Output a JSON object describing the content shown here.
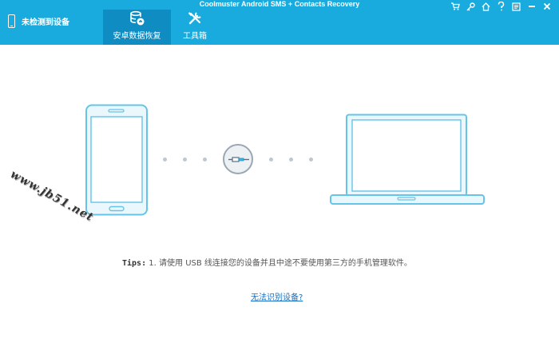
{
  "app": {
    "title": "Coolmuster Android SMS + Contacts Recovery"
  },
  "header": {
    "device_status": "未检测到设备",
    "tabs": [
      {
        "label": "安卓数据恢复",
        "active": true,
        "icon": "database-restore-icon"
      },
      {
        "label": "工具箱",
        "active": false,
        "icon": "tools-icon"
      }
    ],
    "window_controls": [
      "cart-icon",
      "key-icon",
      "home-icon",
      "help-icon",
      "feedback-icon",
      "minimize-icon",
      "close-icon"
    ]
  },
  "main": {
    "tips_label": "Tips:",
    "tips_text": "1. 请使用 USB 线连接您的设备并且中途不要使用第三方的手机管理软件。",
    "help_link": "无法识别设备?"
  },
  "watermark": "www.jb51.net",
  "colors": {
    "header_bg": "#1aabde",
    "active_tab_bg": "#0f8cc2",
    "illustration_stroke": "#5cbfe5",
    "illustration_fill": "#e8f6fc",
    "link": "#1a6fc0"
  }
}
